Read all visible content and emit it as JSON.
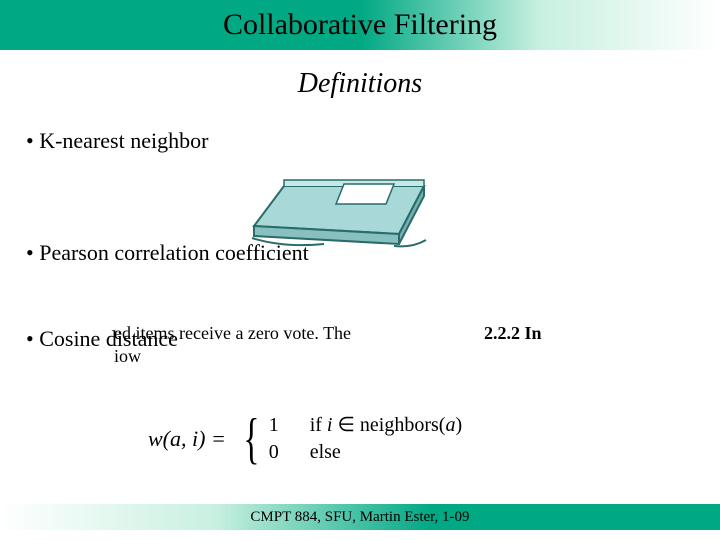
{
  "header": {
    "title": "Collaborative Filtering"
  },
  "subtitle": "Definitions",
  "bullets": {
    "b1": "• K-nearest neighbor",
    "b2": "• Pearson correlation coefficient",
    "b3": "• Cosine distance"
  },
  "snippet": {
    "line1": "ed items receive a zero vote. The",
    "line2": "iow",
    "right": "2.2.2    In"
  },
  "formula": {
    "lhs": "w(a, i) =",
    "case1_val": "1",
    "case1_cond_prefix": "if ",
    "case1_cond_var": "i",
    "case1_cond_in": " ∈ neighbors(",
    "case1_cond_arg": "a",
    "case1_cond_suffix": ")",
    "case2_val": "0",
    "case2_cond": "else"
  },
  "footer": {
    "text": "CMPT 884, SFU, Martin Ester, 1-09"
  },
  "page": ""
}
